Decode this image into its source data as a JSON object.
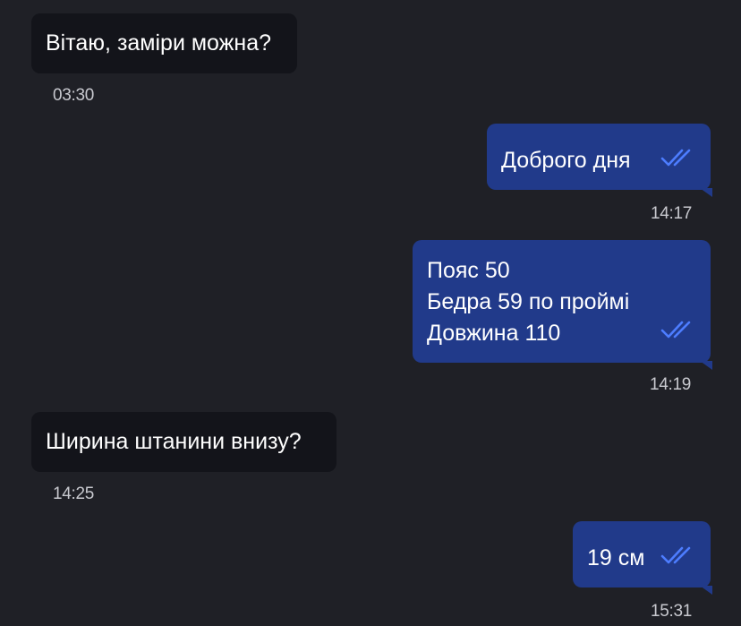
{
  "colors": {
    "background": "#1f2026",
    "incoming_bubble": "#13141a",
    "outgoing_bubble": "#213a8a",
    "read_check": "#4d7dff",
    "timestamp": "#c8c9cf"
  },
  "messages": [
    {
      "direction": "incoming",
      "text": "Вітаю, заміри можна?",
      "time": "03:30"
    },
    {
      "direction": "outgoing",
      "text": "Доброго дня",
      "time": "14:17",
      "status_icon": "double-check-icon"
    },
    {
      "direction": "outgoing",
      "text": "Пояс 50\nБедра 59 по проймі\nДовжина 110",
      "time": "14:19",
      "status_icon": "double-check-icon"
    },
    {
      "direction": "incoming",
      "text": "Ширина штанини внизу?",
      "time": "14:25"
    },
    {
      "direction": "outgoing",
      "text": "19 см",
      "time": "15:31",
      "status_icon": "double-check-icon"
    }
  ]
}
